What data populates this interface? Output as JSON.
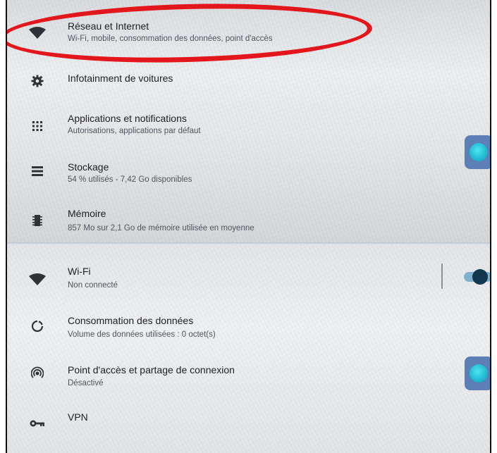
{
  "settings_main": {
    "items": [
      {
        "title": "Réseau et Internet",
        "subtitle": "Wi-Fi, mobile, consommation des données, point d'accès",
        "icon": "wifi-icon"
      },
      {
        "title": "Infotainment de voitures",
        "subtitle": "",
        "icon": "gear-icon"
      },
      {
        "title": "Applications et notifications",
        "subtitle": "Autorisations, applications par défaut",
        "icon": "apps-grid-icon"
      },
      {
        "title": "Stockage",
        "subtitle": "54 % utilisés - 7,42 Go disponibles",
        "icon": "storage-icon"
      },
      {
        "title": "Mémoire",
        "subtitle": "857 Mo sur 2,1 Go de mémoire utilisée en moyenne",
        "icon": "memory-icon"
      }
    ]
  },
  "network": {
    "items": [
      {
        "title": "Wi-Fi",
        "subtitle": "Non connecté",
        "icon": "wifi-icon",
        "toggle_on": true
      },
      {
        "title": "Consommation des données",
        "subtitle": "Volume des données utilisées : 0 octet(s)",
        "icon": "data-usage-icon"
      },
      {
        "title": "Point d'accès et partage de connexion",
        "subtitle": "Désactivé",
        "icon": "hotspot-icon"
      },
      {
        "title": "VPN",
        "subtitle": "",
        "icon": "key-icon"
      }
    ]
  },
  "colors": {
    "annotation": "#e3161b",
    "toggle_knob": "#12384f",
    "toggle_track": "#7fb1cc",
    "floating_button": "#5c7fb5"
  }
}
